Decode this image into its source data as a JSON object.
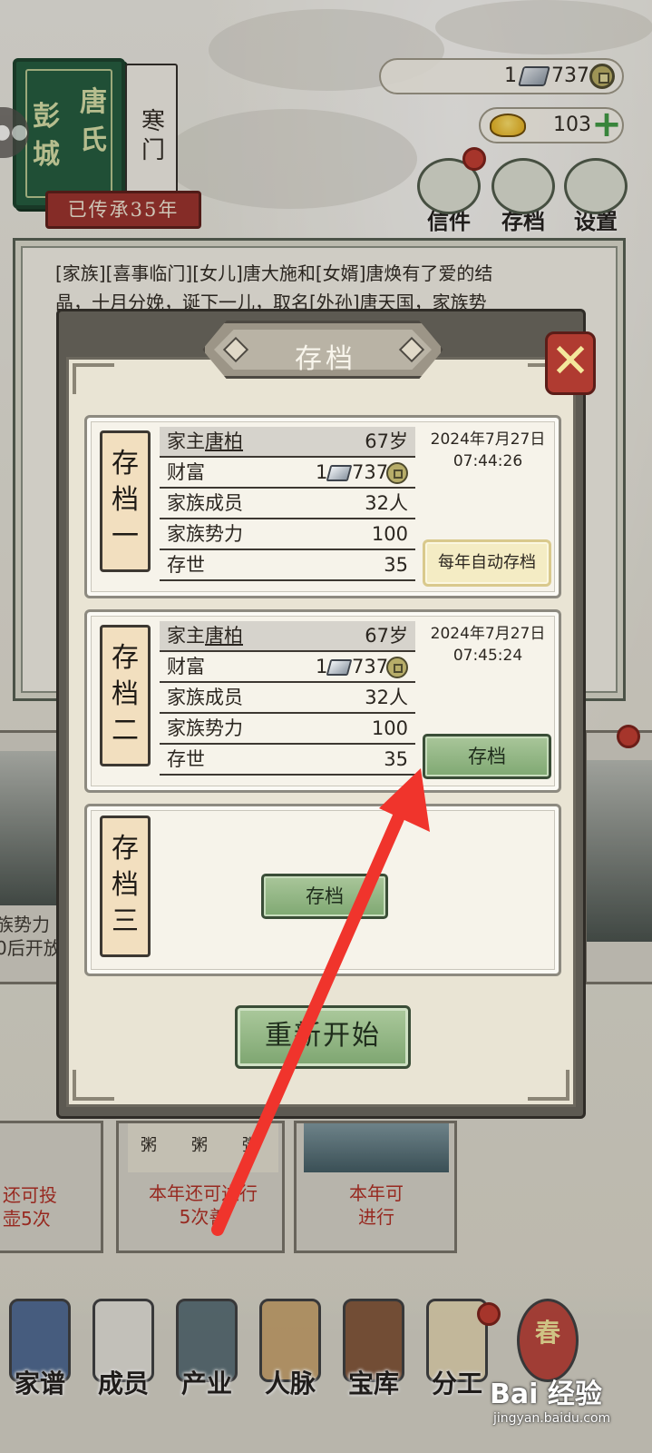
{
  "family_book": {
    "place": "彭城",
    "clan": "唐氏",
    "status": "寒门",
    "inherit": "已传承35年"
  },
  "currency": {
    "silver": "1",
    "coin": "737",
    "gold": "103"
  },
  "top_buttons": [
    "信件",
    "存档",
    "设置"
  ],
  "message_lines": [
    "[家族][喜事临门][女儿]唐大施和[女婿]唐焕有了爱的结",
    "晶，十月分娩，诞下一儿，取名[外孙]唐天国，家族势"
  ],
  "dialog": {
    "title": "存档",
    "close_symbol": "✕",
    "restart_label": "重新开始"
  },
  "slots": [
    {
      "tag": [
        "存",
        "档",
        "一"
      ],
      "head_prefix": "家主",
      "head_name": "唐柏",
      "age": "67岁",
      "wealth_label": "财富",
      "wealth_silver": "1",
      "wealth_coin": "737",
      "members_label": "家族成员",
      "members": "32人",
      "power_label": "家族势力",
      "power": "100",
      "gen_label": "存世",
      "gen": "35",
      "date": "2024年7月27日",
      "time": "07:44:26",
      "button": "每年自动存档"
    },
    {
      "tag": [
        "存",
        "档",
        "二"
      ],
      "head_prefix": "家主",
      "head_name": "唐柏",
      "age": "67岁",
      "wealth_label": "财富",
      "wealth_silver": "1",
      "wealth_coin": "737",
      "members_label": "家族成员",
      "members": "32人",
      "power_label": "家族势力",
      "power": "100",
      "gen_label": "存世",
      "gen": "35",
      "date": "2024年7月27日",
      "time": "07:45:24",
      "button": "存档"
    },
    {
      "tag": [
        "存",
        "档",
        "三"
      ],
      "button": "存档"
    }
  ],
  "side_captions": {
    "left_mid": [
      "族势力",
      "0后开放"
    ],
    "left_bottom": [
      "还可投",
      "壶5次"
    ],
    "center_bottom": [
      "本年还可进行",
      "5次善"
    ],
    "right_bottom": [
      "本年可",
      "进行"
    ],
    "porridge": [
      "粥",
      "粥",
      "粥"
    ]
  },
  "nav": [
    "家谱",
    "成员",
    "产业",
    "人脉",
    "宝库",
    "分工",
    "春"
  ],
  "watermark": {
    "logo": "Bai 经验",
    "site": "jingyan.baidu.com"
  },
  "colors": {
    "accent_green": "#7fa872",
    "badge_red": "#c33a2f",
    "arrow_red": "#f0342c"
  }
}
